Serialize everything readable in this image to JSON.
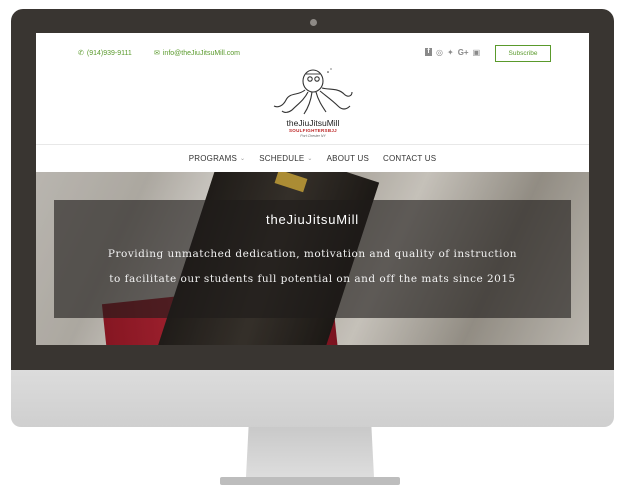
{
  "site": {
    "phone": "(914)939-9111",
    "email": "info@theJiuJitsuMill.com",
    "subscribe_label": "Subscribe",
    "accent_color": "#5a9a2c",
    "social_icons": [
      "facebook-icon",
      "instagram-icon",
      "twitter-icon",
      "google-plus-icon",
      "youtube-icon"
    ]
  },
  "logo": {
    "title": "theJiuJitsuMill",
    "subtitle": "SOULFIGHTERSBJJ",
    "location": "Port Chester NY"
  },
  "nav": {
    "items": [
      {
        "label": "PROGRAMS"
      },
      {
        "label": "SCHEDULE"
      },
      {
        "label": "ABOUT US"
      },
      {
        "label": "CONTACT US"
      }
    ]
  },
  "hero": {
    "title": "theJiuJitsuMill",
    "line1": "Providing unmatched dedication, motivation and quality of instruction",
    "line2": "to facilitate our students full potential on and off the mats since 2015"
  }
}
